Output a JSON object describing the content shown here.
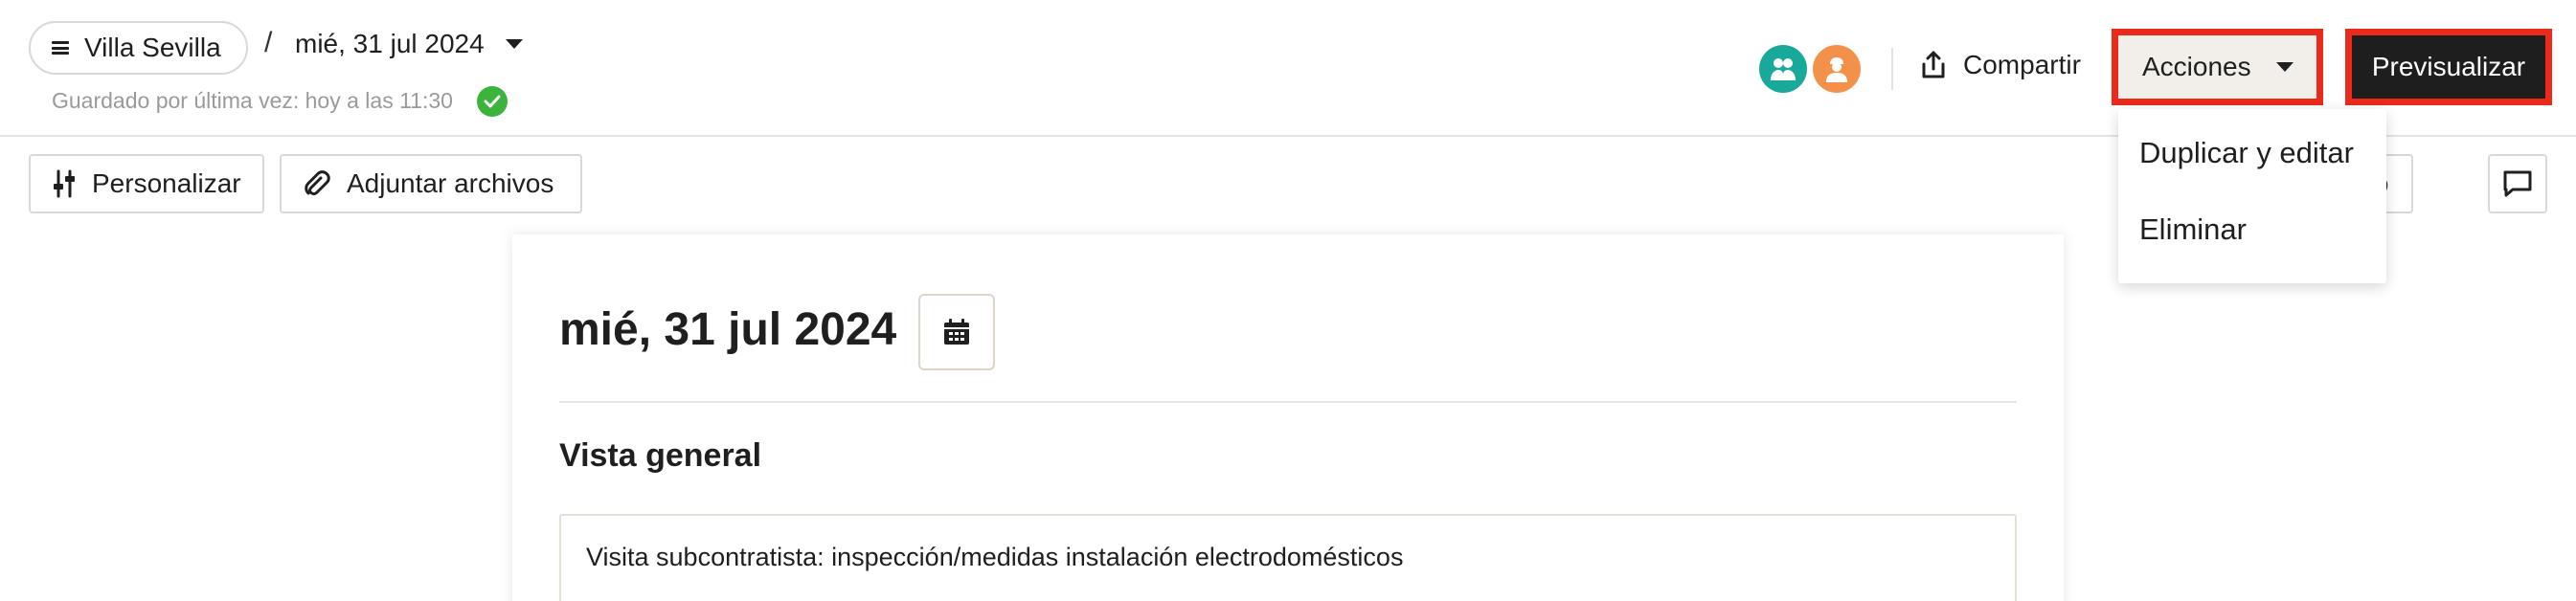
{
  "header": {
    "project_name": "Villa Sevilla",
    "breadcrumb_separator": "/",
    "date": "mié, 31 jul 2024",
    "saved_status": "Guardado por última vez: hoy a las 11:30",
    "share_label": "Compartir",
    "actions_label": "Acciones",
    "preview_label": "Previsualizar",
    "avatars": [
      {
        "icon": "user-group-icon",
        "color": "#19a99a"
      },
      {
        "icon": "worker-icon",
        "color": "#f3914a"
      }
    ]
  },
  "toolbar": {
    "customize_label": "Personalizar",
    "attach_label": "Adjuntar archivos",
    "partial_label": "todo"
  },
  "actions_menu": {
    "items": [
      {
        "label": "Duplicar y editar"
      },
      {
        "label": "Eliminar"
      }
    ]
  },
  "document": {
    "title": "mié, 31 jul 2024",
    "section_title": "Vista general",
    "overview_text": "Visita subcontratista: inspección/medidas instalación electrodomésticos"
  },
  "colors": {
    "highlight": "#ea2a1a",
    "success": "#3cb43c",
    "primary_dark": "#1e1e1e"
  }
}
